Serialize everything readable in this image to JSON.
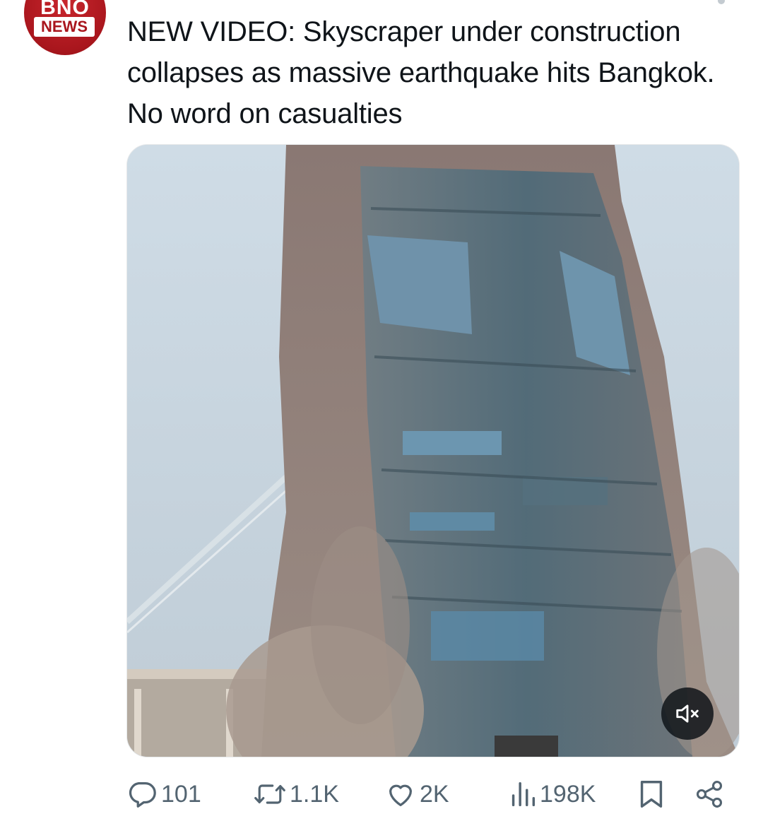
{
  "author": {
    "avatar_logo_top": "BNO",
    "avatar_logo_bottom": "NEWS"
  },
  "tweet": {
    "text": "NEW VIDEO: Skyscraper under construction collapses as massive earthquake hits Bangkok. No word on casualties"
  },
  "media": {
    "type": "video",
    "muted": true,
    "icon": "volume-muted-icon"
  },
  "actions": {
    "replies": "101",
    "reposts": "1.1K",
    "likes": "2K",
    "views": "198K",
    "icons": [
      "reply-icon",
      "repost-icon",
      "like-icon",
      "views-icon",
      "bookmark-icon",
      "share-icon"
    ]
  },
  "colors": {
    "text": "#0f1419",
    "secondary": "#536471",
    "brand_red": "#a9161d"
  }
}
